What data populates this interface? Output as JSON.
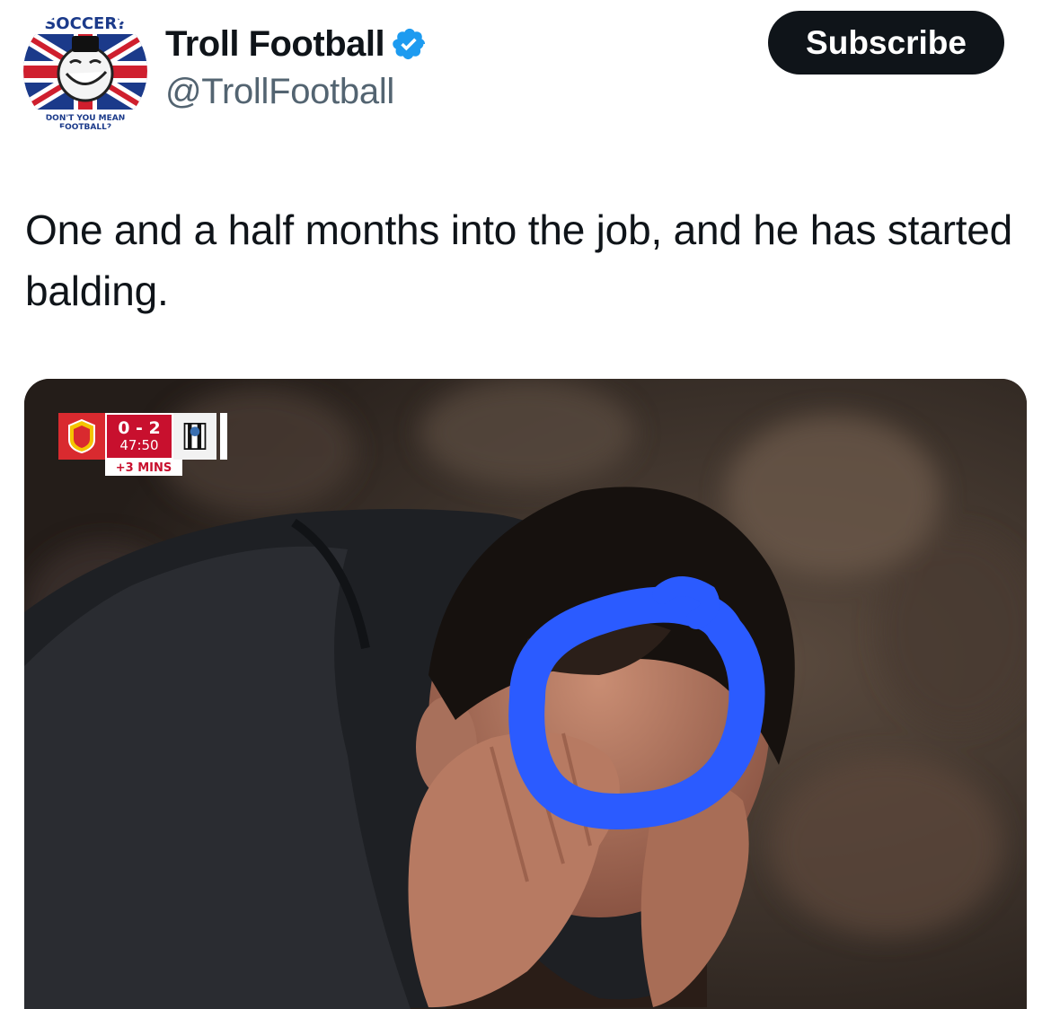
{
  "post": {
    "author": {
      "display_name": "Troll Football",
      "handle": "@TrollFootball",
      "verified": true,
      "avatar_text_top": "SOCCER?",
      "avatar_text_bottom_1": "DON'T YOU MEAN",
      "avatar_text_bottom_2": "FOOTBALL?"
    },
    "subscribe_label": "Subscribe",
    "text": "One and a half months into the job, and he has started balding.",
    "media": {
      "scorebug": {
        "score": "0 - 2",
        "clock": "47:50",
        "added_time": "+3 MINS"
      },
      "annotation_color": "#2b5bff"
    }
  },
  "colors": {
    "verified": "#1d9bf0",
    "text_primary": "#0f1419",
    "text_secondary": "#536471",
    "button_bg": "#0f1419"
  }
}
